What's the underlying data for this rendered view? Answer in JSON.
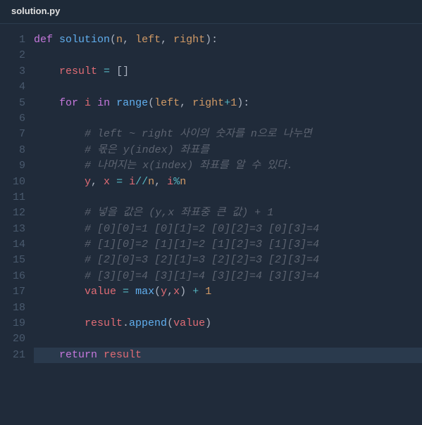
{
  "tab": {
    "filename": "solution.py"
  },
  "lines": [
    [
      {
        "t": "def ",
        "c": "kw"
      },
      {
        "t": "solution",
        "c": "fn"
      },
      {
        "t": "(",
        "c": "punc"
      },
      {
        "t": "n",
        "c": "param"
      },
      {
        "t": ", ",
        "c": "punc"
      },
      {
        "t": "left",
        "c": "param"
      },
      {
        "t": ", ",
        "c": "punc"
      },
      {
        "t": "right",
        "c": "param"
      },
      {
        "t": "):",
        "c": "punc"
      }
    ],
    [],
    [
      {
        "t": "    ",
        "c": "plain"
      },
      {
        "t": "result",
        "c": "var"
      },
      {
        "t": " ",
        "c": "plain"
      },
      {
        "t": "=",
        "c": "op"
      },
      {
        "t": " ",
        "c": "plain"
      },
      {
        "t": "[]",
        "c": "punc"
      }
    ],
    [],
    [
      {
        "t": "    ",
        "c": "plain"
      },
      {
        "t": "for",
        "c": "kw"
      },
      {
        "t": " ",
        "c": "plain"
      },
      {
        "t": "i",
        "c": "var"
      },
      {
        "t": " ",
        "c": "plain"
      },
      {
        "t": "in",
        "c": "kw"
      },
      {
        "t": " ",
        "c": "plain"
      },
      {
        "t": "range",
        "c": "fn"
      },
      {
        "t": "(",
        "c": "punc"
      },
      {
        "t": "left",
        "c": "param"
      },
      {
        "t": ", ",
        "c": "punc"
      },
      {
        "t": "right",
        "c": "param"
      },
      {
        "t": "+",
        "c": "op"
      },
      {
        "t": "1",
        "c": "num"
      },
      {
        "t": "):",
        "c": "punc"
      }
    ],
    [],
    [
      {
        "t": "        ",
        "c": "plain"
      },
      {
        "t": "# left ~ right 사이의 숫자를 n으로 나누면",
        "c": "cmt"
      }
    ],
    [
      {
        "t": "        ",
        "c": "plain"
      },
      {
        "t": "# 몫은 y(index) 좌표를",
        "c": "cmt"
      }
    ],
    [
      {
        "t": "        ",
        "c": "plain"
      },
      {
        "t": "# 나머지는 x(index) 좌표를 알 수 있다.",
        "c": "cmt"
      }
    ],
    [
      {
        "t": "        ",
        "c": "plain"
      },
      {
        "t": "y",
        "c": "var"
      },
      {
        "t": ", ",
        "c": "punc"
      },
      {
        "t": "x",
        "c": "var"
      },
      {
        "t": " ",
        "c": "plain"
      },
      {
        "t": "=",
        "c": "op"
      },
      {
        "t": " ",
        "c": "plain"
      },
      {
        "t": "i",
        "c": "var"
      },
      {
        "t": "//",
        "c": "op"
      },
      {
        "t": "n",
        "c": "param"
      },
      {
        "t": ", ",
        "c": "punc"
      },
      {
        "t": "i",
        "c": "var"
      },
      {
        "t": "%",
        "c": "op"
      },
      {
        "t": "n",
        "c": "param"
      }
    ],
    [],
    [
      {
        "t": "        ",
        "c": "plain"
      },
      {
        "t": "# 넣을 값은 (y,x 좌표중 큰 값) + 1",
        "c": "cmt"
      }
    ],
    [
      {
        "t": "        ",
        "c": "plain"
      },
      {
        "t": "# [0][0]=1 [0][1]=2 [0][2]=3 [0][3]=4",
        "c": "cmt"
      }
    ],
    [
      {
        "t": "        ",
        "c": "plain"
      },
      {
        "t": "# [1][0]=2 [1][1]=2 [1][2]=3 [1][3]=4",
        "c": "cmt"
      }
    ],
    [
      {
        "t": "        ",
        "c": "plain"
      },
      {
        "t": "# [2][0]=3 [2][1]=3 [2][2]=3 [2][3]=4",
        "c": "cmt"
      }
    ],
    [
      {
        "t": "        ",
        "c": "plain"
      },
      {
        "t": "# [3][0]=4 [3][1]=4 [3][2]=4 [3][3]=4",
        "c": "cmt"
      }
    ],
    [
      {
        "t": "        ",
        "c": "plain"
      },
      {
        "t": "value",
        "c": "var"
      },
      {
        "t": " ",
        "c": "plain"
      },
      {
        "t": "=",
        "c": "op"
      },
      {
        "t": " ",
        "c": "plain"
      },
      {
        "t": "max",
        "c": "fn"
      },
      {
        "t": "(",
        "c": "punc"
      },
      {
        "t": "y",
        "c": "var"
      },
      {
        "t": ",",
        "c": "punc"
      },
      {
        "t": "x",
        "c": "var"
      },
      {
        "t": ")",
        "c": "punc"
      },
      {
        "t": " ",
        "c": "plain"
      },
      {
        "t": "+",
        "c": "op"
      },
      {
        "t": " ",
        "c": "plain"
      },
      {
        "t": "1",
        "c": "num"
      }
    ],
    [],
    [
      {
        "t": "        ",
        "c": "plain"
      },
      {
        "t": "result",
        "c": "var"
      },
      {
        "t": ".",
        "c": "punc"
      },
      {
        "t": "append",
        "c": "fn"
      },
      {
        "t": "(",
        "c": "punc"
      },
      {
        "t": "value",
        "c": "var"
      },
      {
        "t": ")",
        "c": "punc"
      }
    ],
    [],
    [
      {
        "t": "    ",
        "c": "plain"
      },
      {
        "t": "return",
        "c": "kw"
      },
      {
        "t": " ",
        "c": "plain"
      },
      {
        "t": "result",
        "c": "var"
      }
    ]
  ],
  "current_line": 21
}
